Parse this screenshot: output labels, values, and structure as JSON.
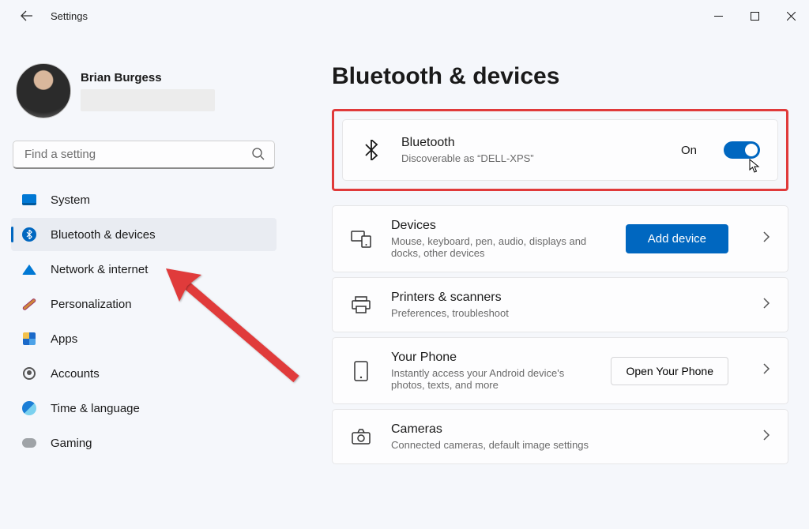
{
  "window": {
    "title": "Settings"
  },
  "user": {
    "name": "Brian Burgess"
  },
  "search": {
    "placeholder": "Find a setting"
  },
  "sidebar": {
    "items": [
      {
        "label": "System"
      },
      {
        "label": "Bluetooth & devices"
      },
      {
        "label": "Network & internet"
      },
      {
        "label": "Personalization"
      },
      {
        "label": "Apps"
      },
      {
        "label": "Accounts"
      },
      {
        "label": "Time & language"
      },
      {
        "label": "Gaming"
      }
    ]
  },
  "page": {
    "title": "Bluetooth & devices",
    "bluetooth": {
      "title": "Bluetooth",
      "subtitle": "Discoverable as “DELL-XPS”",
      "state_label": "On"
    },
    "cards": {
      "devices": {
        "title": "Devices",
        "subtitle": "Mouse, keyboard, pen, audio, displays and docks, other devices",
        "button": "Add device"
      },
      "printers": {
        "title": "Printers & scanners",
        "subtitle": "Preferences, troubleshoot"
      },
      "phone": {
        "title": "Your Phone",
        "subtitle": "Instantly access your Android device's photos, texts, and more",
        "button": "Open Your Phone"
      },
      "cameras": {
        "title": "Cameras",
        "subtitle": "Connected cameras, default image settings"
      }
    }
  }
}
